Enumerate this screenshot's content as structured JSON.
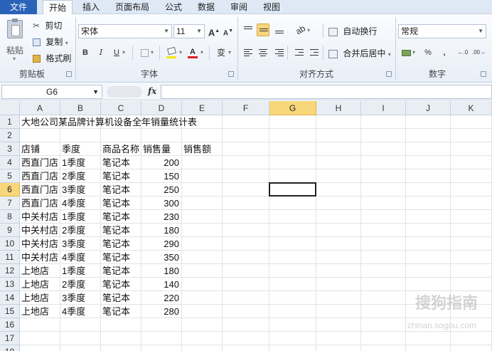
{
  "tabs": [
    "文件",
    "开始",
    "插入",
    "页面布局",
    "公式",
    "数据",
    "审阅",
    "视图"
  ],
  "ribbon": {
    "clipboard": {
      "paste": "粘贴",
      "cut": "剪切",
      "copy": "复制",
      "format_painter": "格式刷",
      "label": "剪贴板"
    },
    "font": {
      "name": "宋体",
      "size": "11",
      "label": "字体",
      "bold": "B",
      "italic": "I",
      "underline": "U",
      "grow": "A",
      "shrink": "A",
      "wen": "变"
    },
    "alignment": {
      "wrap": "自动换行",
      "merge": "合并后居中",
      "label": "对齐方式"
    },
    "number": {
      "format": "常规",
      "percent": "%",
      "comma": ",",
      "label": "数字"
    },
    "accent": "#2a62b7"
  },
  "formula_bar": {
    "name_box": "G6",
    "fx": "fx",
    "value": ""
  },
  "columns": [
    "A",
    "B",
    "C",
    "D",
    "E",
    "F",
    "G",
    "H",
    "I",
    "J",
    "K"
  ],
  "rows": [
    "1",
    "2",
    "3",
    "4",
    "5",
    "6",
    "7",
    "8",
    "9",
    "10",
    "11",
    "12",
    "13",
    "14",
    "15",
    "16",
    "17",
    "18"
  ],
  "selected": {
    "col": "G",
    "row": "6"
  },
  "sheet": {
    "title": "大地公司某品牌计算机设备全年销量统计表",
    "headers": [
      "店铺",
      "季度",
      "商品名称",
      "销售量",
      "销售额"
    ],
    "data": [
      [
        "西直门店",
        "1季度",
        "笔记本",
        "200"
      ],
      [
        "西直门店",
        "2季度",
        "笔记本",
        "150"
      ],
      [
        "西直门店",
        "3季度",
        "笔记本",
        "250"
      ],
      [
        "西直门店",
        "4季度",
        "笔记本",
        "300"
      ],
      [
        "中关村店",
        "1季度",
        "笔记本",
        "230"
      ],
      [
        "中关村店",
        "2季度",
        "笔记本",
        "180"
      ],
      [
        "中关村店",
        "3季度",
        "笔记本",
        "290"
      ],
      [
        "中关村店",
        "4季度",
        "笔记本",
        "350"
      ],
      [
        "上地店",
        "1季度",
        "笔记本",
        "180"
      ],
      [
        "上地店",
        "2季度",
        "笔记本",
        "140"
      ],
      [
        "上地店",
        "3季度",
        "笔记本",
        "220"
      ],
      [
        "上地店",
        "4季度",
        "笔记本",
        "280"
      ]
    ]
  },
  "watermark": {
    "main": "搜狗指南",
    "sub": "zhinan.sogou.com"
  }
}
